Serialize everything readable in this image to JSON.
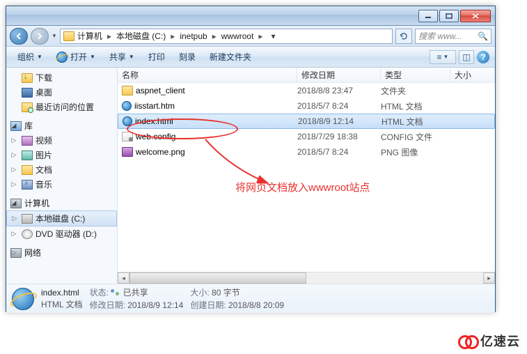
{
  "window": {
    "min": "min",
    "max": "max",
    "close": "close"
  },
  "address": {
    "crumbs": [
      "计算机",
      "本地磁盘 (C:)",
      "inetpub",
      "wwwroot"
    ],
    "search_placeholder": "搜索 www..."
  },
  "toolbar": {
    "organize": "组织",
    "open": "打开",
    "share": "共享",
    "print": "打印",
    "burn": "刻录",
    "newfolder": "新建文件夹"
  },
  "nav": {
    "downloads": "下载",
    "desktop": "桌面",
    "recent": "最近访问的位置",
    "libraries": "库",
    "videos": "视频",
    "pictures": "图片",
    "documents": "文档",
    "music": "音乐",
    "computer": "计算机",
    "disk_c": "本地磁盘 (C:)",
    "dvd": "DVD 驱动器 (D:)",
    "network": "网络"
  },
  "columns": {
    "name": "名称",
    "date": "修改日期",
    "type": "类型",
    "size": "大小"
  },
  "files": [
    {
      "name": "aspnet_client",
      "date": "2018/8/8 23:47",
      "type": "文件夹",
      "icon": "folder"
    },
    {
      "name": "iisstart.htm",
      "date": "2018/5/7 8:24",
      "type": "HTML 文档",
      "icon": "ie"
    },
    {
      "name": "index.html",
      "date": "2018/8/9 12:14",
      "type": "HTML 文档",
      "icon": "ie",
      "selected": true
    },
    {
      "name": "web.config",
      "date": "2018/7/29 18:38",
      "type": "CONFIG 文件",
      "icon": "cfg"
    },
    {
      "name": "welcome.png",
      "date": "2018/5/7 8:24",
      "type": "PNG 图像",
      "icon": "png"
    }
  ],
  "details": {
    "filename": "index.html",
    "filetype": "HTML 文档",
    "state_label": "状态:",
    "state_value": "已共享",
    "size_label": "大小:",
    "size_value": "80 字节",
    "moddate_label": "修改日期:",
    "moddate_value": "2018/8/9 12:14",
    "createdate_label": "创建日期:",
    "createdate_value": "2018/8/8 20:09"
  },
  "annotation": "将网页文档放入wwwroot站点",
  "logo": "亿速云"
}
